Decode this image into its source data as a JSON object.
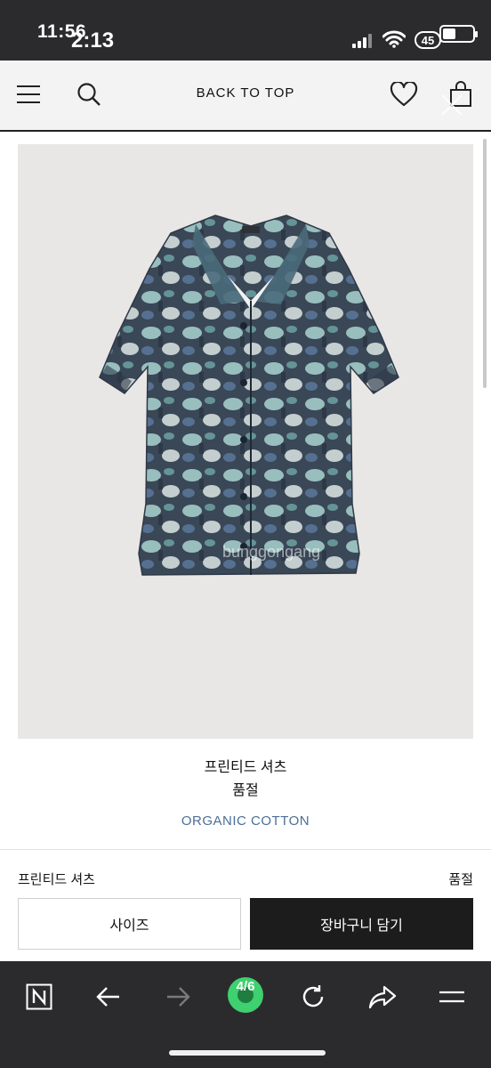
{
  "status_bar": {
    "time_primary": "11:56",
    "time_overlay": "2:13",
    "battery_badge": "45"
  },
  "header": {
    "back_to_top": "BACK TO TOP"
  },
  "product": {
    "name": "프린티드 셔츠",
    "status": "품절",
    "material": "ORGANIC COTTON",
    "watermark": "bunggongang"
  },
  "purchase_bar": {
    "name": "프린티드 셔츠",
    "status": "품절",
    "size_button": "사이즈",
    "cart_button": "장바구니 담기"
  },
  "browser": {
    "tab_counter": "4/6"
  }
}
